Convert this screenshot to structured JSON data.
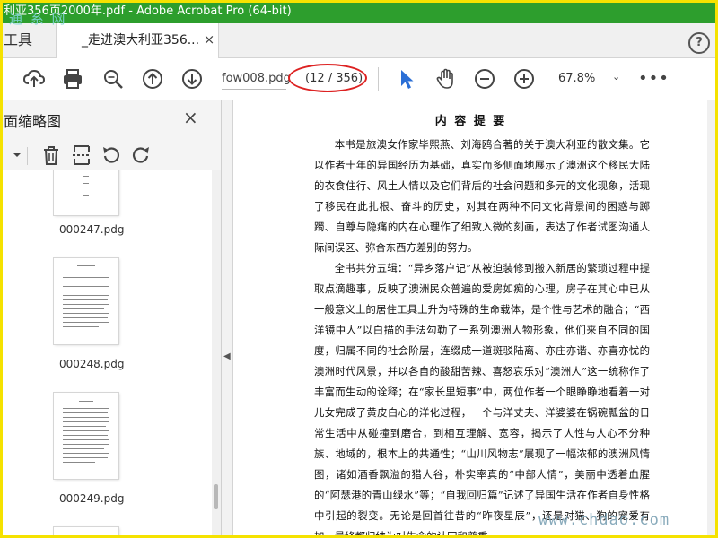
{
  "window": {
    "title": "利亚356页2000年.pdf - Adobe Acrobat Pro (64-bit)"
  },
  "watermark_top": "通 系 网",
  "watermark_bottom": "www.chdao.com",
  "tabs": {
    "tools_label": "工具",
    "doc_label": "_走进澳大利亚356...",
    "close_glyph": "×"
  },
  "help": {
    "glyph": "?"
  },
  "toolbar": {
    "page_field": "fow008.pdg",
    "page_count": "(12 / 356)",
    "zoom": "67.8%",
    "zoom_chevron": "⌄",
    "more": "•••",
    "icons": [
      "upload-cloud-icon",
      "print-icon",
      "zoom-search-icon",
      "prev-page-icon",
      "next-page-icon",
      "select-cursor-icon",
      "hand-tool-icon",
      "zoom-out-icon",
      "zoom-in-icon"
    ]
  },
  "panel": {
    "title": "面缩略图",
    "close_glyph": "×",
    "thumbnails": [
      {
        "label": "000247.pdg"
      },
      {
        "label": "000248.pdg"
      },
      {
        "label": "000249.pdg"
      }
    ]
  },
  "document": {
    "title": "内 容 提 要",
    "paragraphs": [
      "本书是旅澳女作家毕熙燕、刘海鸥合著的关于澳大利亚的散文集。它以作者十年的异国经历为基础，真实而多侧面地展示了澳洲这个移民大陆的衣食住行、风土人情以及它们背后的社会问题和多元的文化现象，活现了移民在此扎根、奋斗的历史，对其在两种不同文化背景间的困惑与踯躅、自尊与隐痛的内在心理作了细致入微的刻画，表达了作者试图沟通人际间误区、弥合东西方差别的努力。",
      "全书共分五辑：“异乡落户记”从被迫装修到搬入新居的繁琐过程中提取点滴趣事，反映了澳洲民众普遍的爱房如痴的心理，房子在其心中已从一般意义上的居住工具上升为特殊的生命载体，是个性与艺术的融合；“西洋镜中人”以白描的手法勾勒了一系列澳洲人物形象，他们来自不同的国度，归属不同的社会阶层，连缀成一道斑驳陆离、亦庄亦谐、亦喜亦忧的澳洲时代风景，并以各自的酸甜苦辣、喜怒哀乐对“澳洲人”这一统称作了丰富而生动的诠释；在“家长里短事”中，两位作者一个眼睁睁地看着一对儿女完成了黄皮白心的洋化过程，一个与洋丈夫、洋婆婆在锅碗瓢盆的日常生活中从碰撞到磨合，到相互理解、宽容，揭示了人性与人心不分种族、地域的，根本上的共通性；“山川风物志”展现了一幅浓郁的澳洲风情图，诸如酒香飘溢的猎人谷，朴实率真的“中部人情”，美丽中透着血腥的“阿瑟港的青山绿水”等；“自我回归篇”记述了异国生活在作者自身性格中引起的裂变。无论是回首往昔的“昨夜星辰”，还是对猫、狗的宠爱有加，最终都归结为对生命的认同和尊重。"
    ]
  },
  "colors": {
    "titlebar": "#2d9e2d",
    "frame": "#f5e200",
    "annotation": "#dd2222",
    "accent": "#2b6fd6"
  }
}
